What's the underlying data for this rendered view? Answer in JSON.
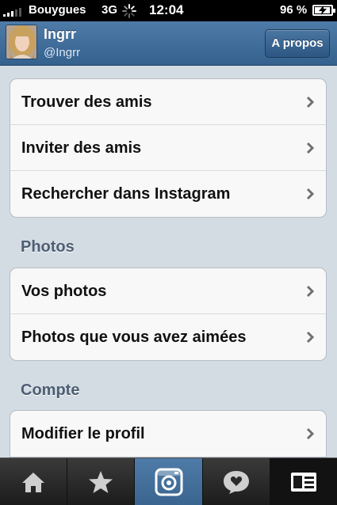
{
  "status_bar": {
    "carrier": "Bouygues",
    "network": "3G",
    "time": "12:04",
    "battery": "96 %",
    "battery_level": 0.96
  },
  "header": {
    "username": "Ingrr",
    "handle": "@Ingrr",
    "about_button": "A propos"
  },
  "menu": {
    "group1": [
      "Trouver des amis",
      "Inviter des amis",
      "Rechercher dans Instagram"
    ],
    "photos_title": "Photos",
    "photos": [
      "Vos photos",
      "Photos que vous avez aimées"
    ],
    "account_title": "Compte",
    "account": [
      "Modifier le profil"
    ]
  },
  "tabs": [
    "home-icon",
    "star-icon",
    "camera-icon",
    "heart-bubble-icon",
    "profile-card-icon"
  ],
  "colors": {
    "header": "#3f6b97",
    "active_tab": "#4f7ba8",
    "background": "#d3dbe3"
  }
}
